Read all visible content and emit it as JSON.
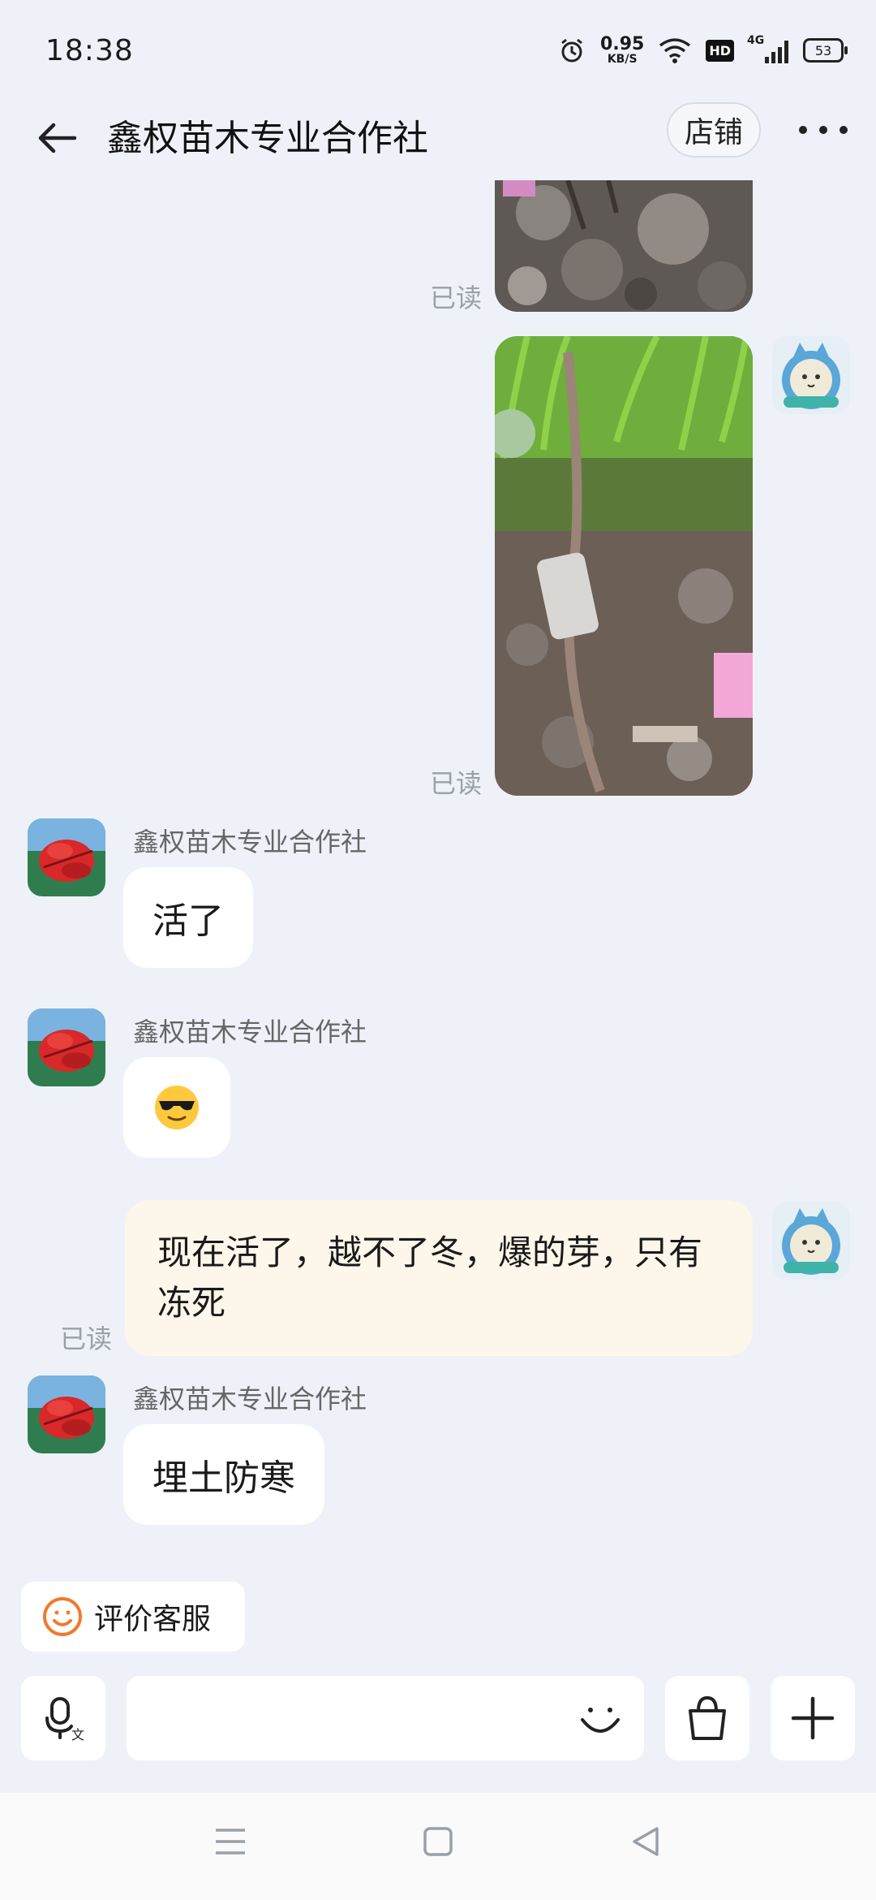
{
  "status_bar": {
    "time": "18:38",
    "net_speed": "0.95",
    "net_unit": "KB/S",
    "hd_label": "HD",
    "signal_label": "4G",
    "battery": "53",
    "icons": [
      "alarm-icon",
      "wifi-icon",
      "hd-icon",
      "signal-icon",
      "battery-icon"
    ]
  },
  "header": {
    "title": "鑫权苗木专业合作社",
    "store_button": "店铺",
    "icons": [
      "back-arrow-icon",
      "more-icon"
    ]
  },
  "messages": [
    {
      "type": "image",
      "from": "me",
      "read_label": "已读",
      "alt": "soil photo"
    },
    {
      "type": "image",
      "from": "me",
      "read_label": "已读",
      "alt": "seedling photo"
    },
    {
      "type": "text",
      "from": "shop",
      "sender": "鑫权苗木专业合作社",
      "text": "活了"
    },
    {
      "type": "emoji",
      "from": "shop",
      "sender": "鑫权苗木专业合作社",
      "text": "😎"
    },
    {
      "type": "text",
      "from": "me",
      "read_label": "已读",
      "text": "现在活了，越不了冬，爆的芽，只有冻死"
    },
    {
      "type": "text",
      "from": "shop",
      "sender": "鑫权苗木专业合作社",
      "text": "埋土防寒"
    }
  ],
  "rate_button": {
    "label": "评价客服",
    "icon": "smile-icon"
  },
  "input_bar": {
    "placeholder": "",
    "icons": [
      "voice-icon",
      "emoji-icon",
      "shopping-bag-icon",
      "plus-icon"
    ]
  },
  "nav_bar": {
    "icons": [
      "menu-icon",
      "home-icon",
      "back-icon"
    ]
  },
  "colors": {
    "background": "#EEF2F8",
    "bubble_me": "#FDF6EA",
    "bubble_other": "#FFFFFF",
    "accent_orange": "#F07A2C"
  }
}
